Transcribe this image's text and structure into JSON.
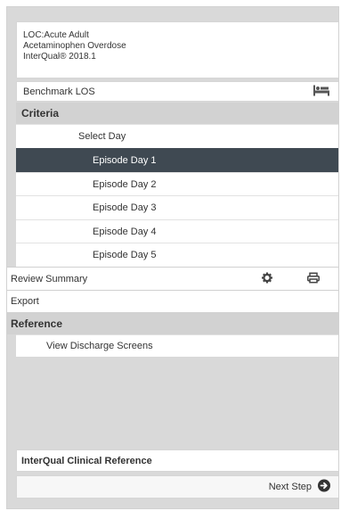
{
  "header": {
    "line1": "LOC:Acute Adult",
    "line2": "Acetaminophen Overdose",
    "line3": "InterQual® 2018.1"
  },
  "benchmark": {
    "label": "Benchmark LOS",
    "icon": "bed-icon"
  },
  "criteria": {
    "heading": "Criteria",
    "select_day": "Select Day",
    "days": [
      "Episode Day 1",
      "Episode Day 2",
      "Episode Day 3",
      "Episode Day 4",
      "Episode Day 5"
    ],
    "active_index": 0,
    "active_color": "#3f4952"
  },
  "review_summary": {
    "label": "Review Summary",
    "icons": [
      "gear-icon",
      "print-icon"
    ]
  },
  "export": {
    "label": "Export"
  },
  "reference": {
    "heading": "Reference",
    "view_discharge": "View Discharge Screens"
  },
  "clinical_reference": {
    "label": "InterQual Clinical Reference"
  },
  "next_step": {
    "label": "Next Step",
    "icon": "arrow-circle-right-icon"
  }
}
